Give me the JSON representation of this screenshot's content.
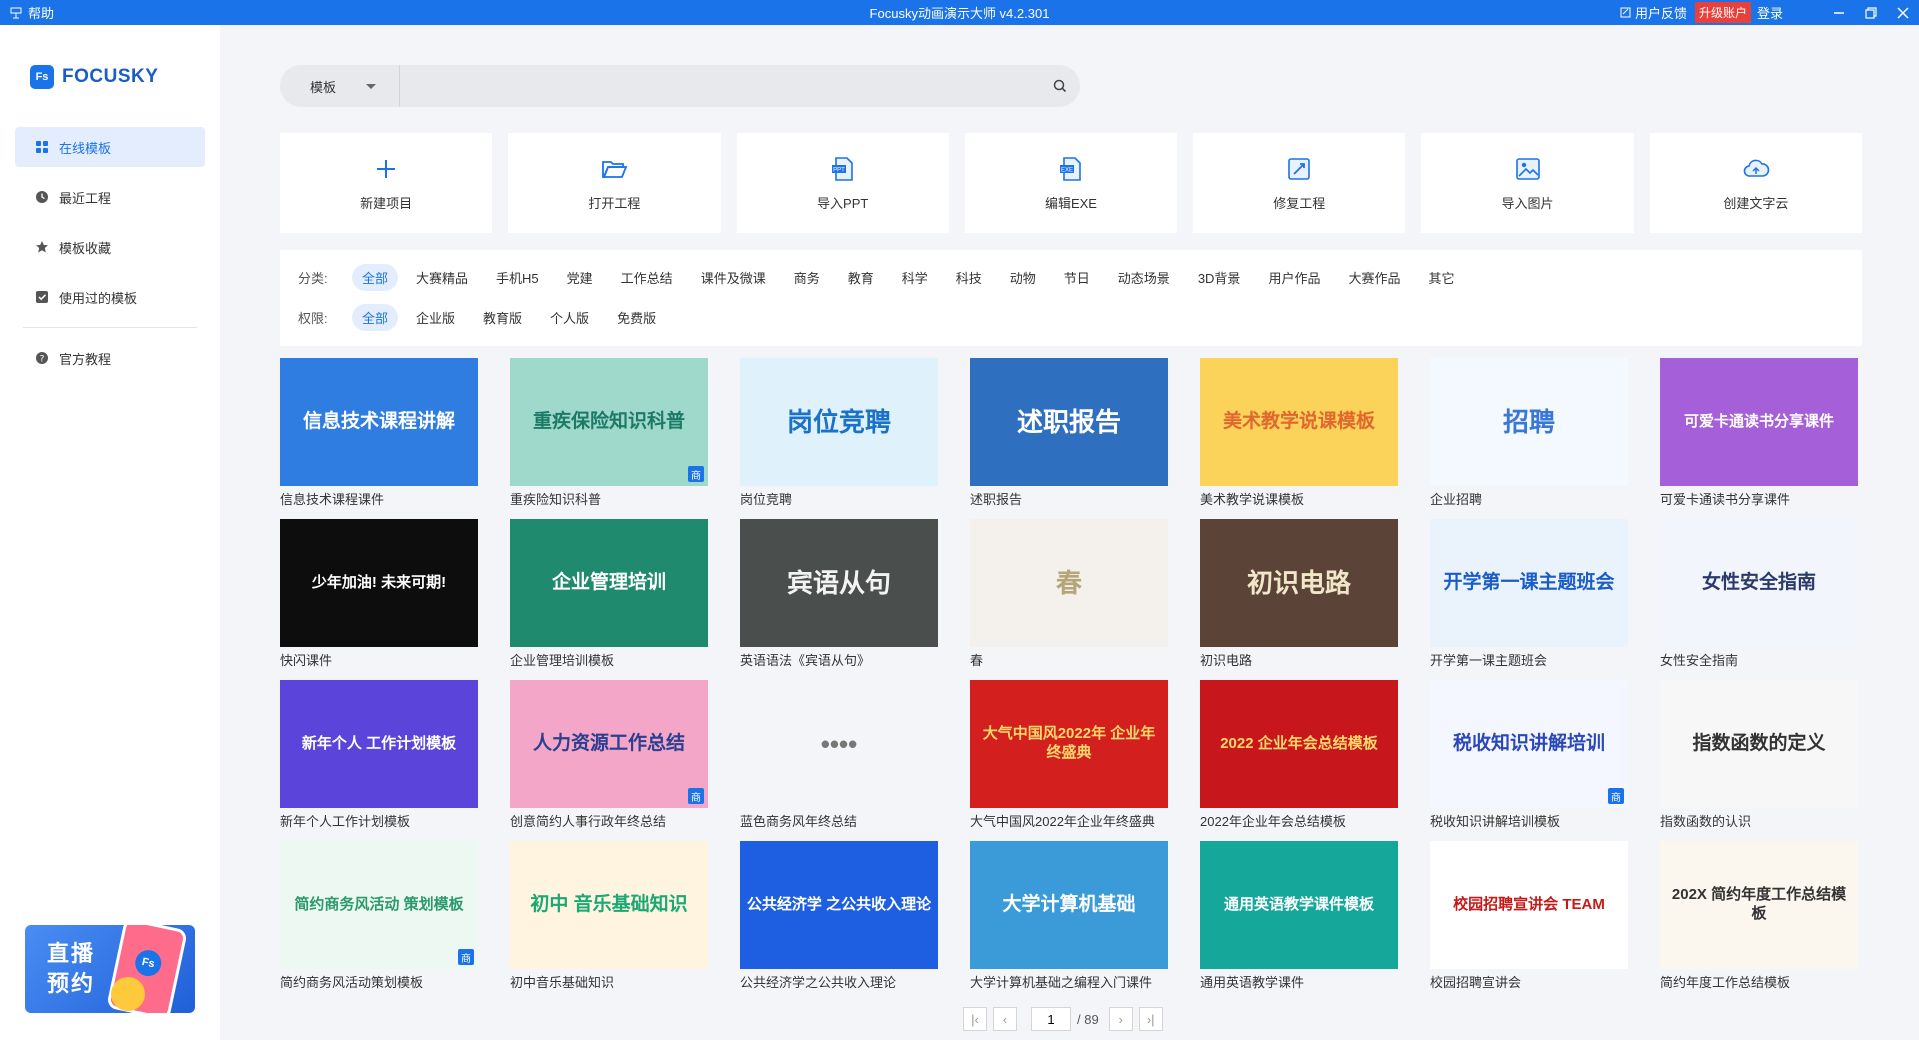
{
  "titlebar": {
    "help": "帮助",
    "title": "Focusky动画演示大师 v4.2.301",
    "feedback": "用户反馈",
    "upgrade": "升级账户",
    "login": "登录"
  },
  "sidebar": {
    "logo_mark": "Fs",
    "logo_text": "FOCUSKY",
    "items": [
      {
        "label": "在线模板",
        "icon": "grid-icon",
        "active": true
      },
      {
        "label": "最近工程",
        "icon": "clock-icon"
      },
      {
        "label": "模板收藏",
        "icon": "star-icon"
      },
      {
        "label": "使用过的模板",
        "icon": "check-square-icon"
      },
      {
        "label": "官方教程",
        "icon": "help-circle-icon"
      }
    ],
    "banner": {
      "line1": "直播",
      "line2": "预约",
      "badge": "Fs"
    }
  },
  "search": {
    "scope": "模板",
    "placeholder": ""
  },
  "actions": [
    {
      "label": "新建项目",
      "icon": "plus-icon"
    },
    {
      "label": "打开工程",
      "icon": "folder-open-icon"
    },
    {
      "label": "导入PPT",
      "icon": "ppt-file-icon"
    },
    {
      "label": "编辑EXE",
      "icon": "exe-file-icon"
    },
    {
      "label": "修复工程",
      "icon": "repair-icon"
    },
    {
      "label": "导入图片",
      "icon": "image-icon"
    },
    {
      "label": "创建文字云",
      "icon": "cloud-icon"
    }
  ],
  "filters": {
    "category_label": "分类:",
    "categories": [
      "全部",
      "大赛精品",
      "手机H5",
      "党建",
      "工作总结",
      "课件及微课",
      "商务",
      "教育",
      "科学",
      "科技",
      "动物",
      "节日",
      "动态场景",
      "3D背景",
      "用户作品",
      "大赛作品",
      "其它"
    ],
    "permission_label": "权限:",
    "permissions": [
      "全部",
      "企业版",
      "教育版",
      "个人版",
      "免费版"
    ]
  },
  "templates": [
    {
      "title": "信息技术课程课件",
      "thumb": "信息技术课程讲解",
      "bg": "#2f7de1",
      "fg": "#ffffff",
      "biz": false
    },
    {
      "title": "重疾险知识科普",
      "thumb": "重疾保险知识科普",
      "bg": "#9ed9cc",
      "fg": "#1e7a68",
      "biz": true
    },
    {
      "title": "岗位竞聘",
      "thumb": "岗位竞聘",
      "bg": "#dff1fb",
      "fg": "#1a73c8",
      "biz": false
    },
    {
      "title": "述职报告",
      "thumb": "述职报告",
      "bg": "#2f6fbf",
      "fg": "#ffffff",
      "biz": false
    },
    {
      "title": "美术教学说课模板",
      "thumb": "美术教学说课模板",
      "bg": "#fbd25a",
      "fg": "#e0672e",
      "biz": false
    },
    {
      "title": "企业招聘",
      "thumb": "招聘",
      "bg": "#f4f8ff",
      "fg": "#3a78d8",
      "biz": false
    },
    {
      "title": "可爱卡通读书分享课件",
      "thumb": "可爱卡通读书分享课件",
      "bg": "#a55fd8",
      "fg": "#ffffff",
      "biz": false
    },
    {
      "title": "快闪课件",
      "thumb": "少年加油! 未来可期!",
      "bg": "#0d0d0d",
      "fg": "#ffffff",
      "biz": false
    },
    {
      "title": "企业管理培训模板",
      "thumb": "企业管理培训",
      "bg": "#1f8a6d",
      "fg": "#ffffff",
      "biz": false
    },
    {
      "title": "英语语法《宾语从句》",
      "thumb": "宾语从句",
      "bg": "#4a4f4d",
      "fg": "#f3f3f3",
      "biz": false
    },
    {
      "title": "春",
      "thumb": "春",
      "bg": "#f4f1ec",
      "fg": "#b7a57a",
      "biz": false
    },
    {
      "title": "初识电路",
      "thumb": "初识电路",
      "bg": "#5b4437",
      "fg": "#f0e6c8",
      "biz": false
    },
    {
      "title": "开学第一课主题班会",
      "thumb": "开学第一课主题班会",
      "bg": "#eaf2fc",
      "fg": "#1a5cc8",
      "biz": false
    },
    {
      "title": "女性安全指南",
      "thumb": "女性安全指南",
      "bg": "#f2f5fb",
      "fg": "#2c3a6b",
      "biz": false
    },
    {
      "title": "新年个人工作计划模板",
      "thumb": "新年个人 工作计划模板",
      "bg": "#5a44d9",
      "fg": "#ffffff",
      "biz": false
    },
    {
      "title": "创意简约人事行政年终总结",
      "thumb": "人力资源工作总结",
      "bg": "#f3a6c8",
      "fg": "#2a3f8f",
      "biz": true
    },
    {
      "title": "蓝色商务风年终总结",
      "thumb": "••••",
      "bg": "#f4f5f8",
      "fg": "#777777",
      "biz": false
    },
    {
      "title": "大气中国风2022年企业年终盛典",
      "thumb": "大气中国风2022年 企业年终盛典",
      "bg": "#d41f1f",
      "fg": "#ffd86b",
      "biz": false
    },
    {
      "title": "2022年企业年会总结模板",
      "thumb": "2022 企业年会总结模板",
      "bg": "#c8161d",
      "fg": "#ffd86b",
      "biz": false
    },
    {
      "title": "税收知识讲解培训模板",
      "thumb": "税收知识讲解培训",
      "bg": "#f4f7ff",
      "fg": "#2b48b8",
      "biz": true
    },
    {
      "title": "指数函数的认识",
      "thumb": "指数函数的定义",
      "bg": "#f7f7f7",
      "fg": "#333333",
      "biz": false
    },
    {
      "title": "简约商务风活动策划模板",
      "thumb": "简约商务风活动 策划模板",
      "bg": "#eef8f3",
      "fg": "#2a9a6a",
      "biz": true
    },
    {
      "title": "初中音乐基础知识",
      "thumb": "初中 音乐基础知识",
      "bg": "#fff4df",
      "fg": "#1aa874",
      "biz": false
    },
    {
      "title": "公共经济学之公共收入理论",
      "thumb": "公共经济学 之公共收入理论",
      "bg": "#1d5fe0",
      "fg": "#ffffff",
      "biz": false
    },
    {
      "title": "大学计算机基础之编程入门课件",
      "thumb": "大学计算机基础",
      "bg": "#3a9bd8",
      "fg": "#ffffff",
      "biz": false
    },
    {
      "title": "通用英语教学课件",
      "thumb": "通用英语教学课件模板",
      "bg": "#16a79b",
      "fg": "#ffffff",
      "biz": false
    },
    {
      "title": "校园招聘宣讲会",
      "thumb": "校园招聘宣讲会 TEAM",
      "bg": "#ffffff",
      "fg": "#c41a1a",
      "biz": false
    },
    {
      "title": "简约年度工作总结模板",
      "thumb": "202X 简约年度工作总结模板",
      "bg": "#fbf7ef",
      "fg": "#333333",
      "biz": false
    }
  ],
  "pagination": {
    "current": "1",
    "total": "/ 89"
  },
  "colors": {
    "accent": "#1a73e8",
    "upgrade": "#e8413b",
    "background": "#f4f5f8"
  }
}
